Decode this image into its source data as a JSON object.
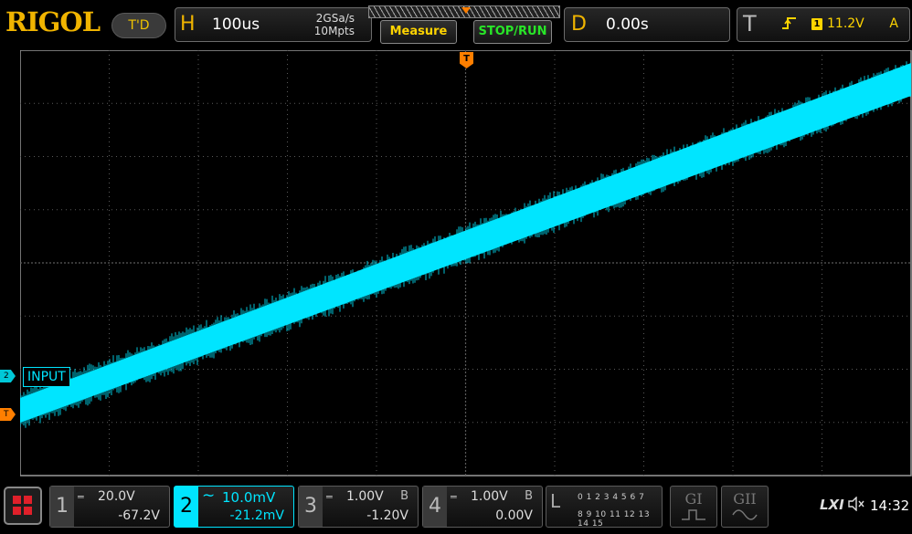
{
  "brand": {
    "logo": "RIGOL",
    "mode_button": "T'D"
  },
  "horizontal": {
    "letter": "H",
    "timebase": "100us",
    "sample_rate": "2GSa/s",
    "memory_depth": "10Mpts"
  },
  "buttons": {
    "measure": "Measure",
    "stop_run": "STOP/RUN"
  },
  "delay": {
    "letter": "D",
    "value": "0.00s"
  },
  "trigger": {
    "letter": "T",
    "edge_icon": "rising-edge-icon",
    "source": "1",
    "level": "11.2V",
    "sweep": "A",
    "marker": "T"
  },
  "markers": {
    "channel2": "2",
    "trigger_level": "T"
  },
  "waveform": {
    "label": "INPUT",
    "color": "#00e5ff"
  },
  "channels": [
    {
      "num": "1",
      "coupling": "═",
      "scale": "20.0V",
      "bw": "",
      "offset": "-67.2V"
    },
    {
      "num": "2",
      "coupling": "∼",
      "scale": "10.0mV",
      "bw": "",
      "offset": "-21.2mV"
    },
    {
      "num": "3",
      "coupling": "═",
      "scale": "1.00V",
      "bw": "B",
      "offset": "-1.20V"
    },
    {
      "num": "4",
      "coupling": "═",
      "scale": "1.00V",
      "bw": "B",
      "offset": "0.00V"
    }
  ],
  "logic": {
    "letter": "L",
    "row1": "0 1 2 3  4 5 6 7",
    "row2": "8 9 10 11 12 13 14 15"
  },
  "generators": [
    {
      "label": "GI"
    },
    {
      "label": "GII"
    }
  ],
  "status": {
    "lxi": "LXI",
    "clock": "14:32"
  },
  "colors": {
    "accent": "#f0b400",
    "ch2": "#00e5ff",
    "trigger": "#ff7f00",
    "run": "#28e628"
  }
}
